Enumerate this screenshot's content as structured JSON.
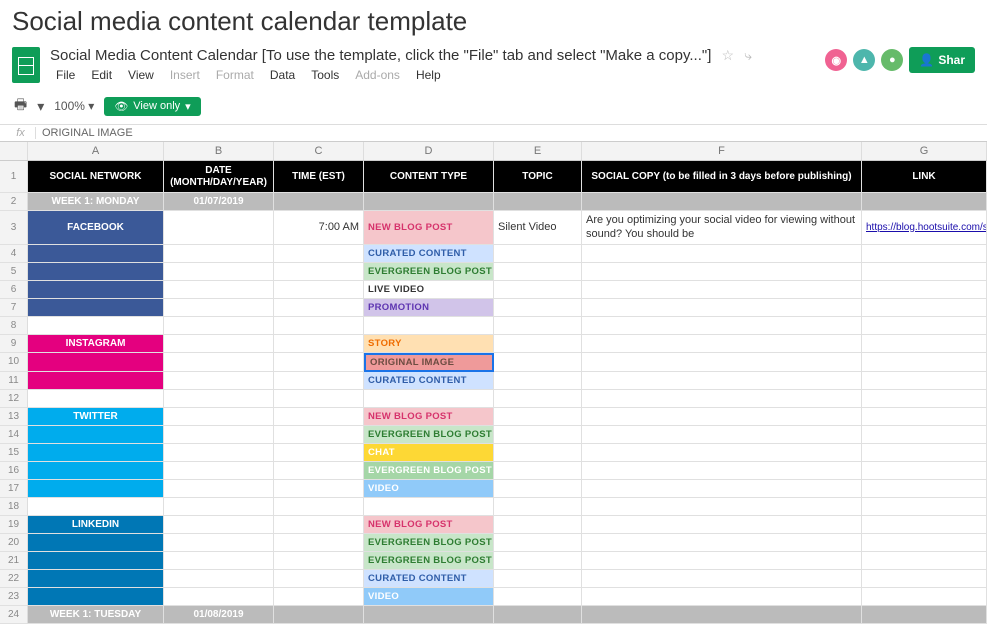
{
  "page_title": "Social media content calendar template",
  "doc_title": "Social Media Content Calendar [To use the template, click the \"File\" tab and select \"Make a copy...\"]",
  "menus": [
    "File",
    "Edit",
    "View",
    "Insert",
    "Format",
    "Data",
    "Tools",
    "Add-ons",
    "Help"
  ],
  "menus_disabled": [
    "Insert",
    "Format",
    "Add-ons"
  ],
  "share_label": "Shar",
  "zoom": "100%",
  "view_only": "View only",
  "fx_value": "ORIGINAL IMAGE",
  "columns": [
    "",
    "A",
    "B",
    "C",
    "D",
    "E",
    "F",
    "G"
  ],
  "headers": {
    "A": "SOCIAL NETWORK",
    "B": "DATE\n(MONTH/DAY/YEAR)",
    "C": "TIME (EST)",
    "D": "CONTENT TYPE",
    "E": "TOPIC",
    "F": "SOCIAL COPY (to be filled in 3 days before publishing)",
    "G": "LINK"
  },
  "rows": [
    {
      "n": 2,
      "type": "day",
      "A": "WEEK 1: MONDAY",
      "B": "01/07/2019"
    },
    {
      "n": 3,
      "type": "data",
      "network": "fb",
      "A": "FACEBOOK",
      "C": "7:00 AM",
      "D": "NEW BLOG POST",
      "Dclass": "ct-new",
      "E": "Silent Video",
      "F": "Are you optimizing your social video for viewing without sound? You should be",
      "G": "https://blog.hootsuite.com/silent"
    },
    {
      "n": 4,
      "type": "data",
      "network": "fb",
      "D": "CURATED CONTENT",
      "Dclass": "ct-curated"
    },
    {
      "n": 5,
      "type": "data",
      "network": "fb",
      "D": "EVERGREEN BLOG POST",
      "Dclass": "ct-evergreen"
    },
    {
      "n": 6,
      "type": "data",
      "network": "fb",
      "D": "LIVE VIDEO",
      "Dclass": "ct-live"
    },
    {
      "n": 7,
      "type": "data",
      "network": "fb",
      "D": "PROMOTION",
      "Dclass": "ct-promo"
    },
    {
      "n": 8,
      "type": "blank"
    },
    {
      "n": 9,
      "type": "data",
      "network": "ig",
      "A": "INSTAGRAM",
      "D": "STORY",
      "Dclass": "ct-story"
    },
    {
      "n": 10,
      "type": "data",
      "network": "ig",
      "D": "ORIGINAL IMAGE",
      "Dclass": "ct-original"
    },
    {
      "n": 11,
      "type": "data",
      "network": "ig",
      "D": "CURATED CONTENT",
      "Dclass": "ct-curated"
    },
    {
      "n": 12,
      "type": "blank"
    },
    {
      "n": 13,
      "type": "data",
      "network": "tw",
      "A": "TWITTER",
      "D": "NEW BLOG POST",
      "Dclass": "ct-new"
    },
    {
      "n": 14,
      "type": "data",
      "network": "tw",
      "D": "EVERGREEN BLOG POST",
      "Dclass": "ct-evergreen"
    },
    {
      "n": 15,
      "type": "data",
      "network": "tw",
      "D": "CHAT",
      "Dclass": "ct-chat"
    },
    {
      "n": 16,
      "type": "data",
      "network": "tw",
      "D": "EVERGREEN BLOG POST",
      "Dclass": "ct-evergreen2"
    },
    {
      "n": 17,
      "type": "data",
      "network": "tw",
      "D": "VIDEO",
      "Dclass": "ct-video"
    },
    {
      "n": 18,
      "type": "blank"
    },
    {
      "n": 19,
      "type": "data",
      "network": "li",
      "A": "LINKEDIN",
      "D": "NEW BLOG POST",
      "Dclass": "ct-new"
    },
    {
      "n": 20,
      "type": "data",
      "network": "li",
      "D": "EVERGREEN BLOG POST",
      "Dclass": "ct-evergreen"
    },
    {
      "n": 21,
      "type": "data",
      "network": "li",
      "D": "EVERGREEN BLOG POST",
      "Dclass": "ct-evergreen"
    },
    {
      "n": 22,
      "type": "data",
      "network": "li",
      "D": "CURATED CONTENT",
      "Dclass": "ct-curated"
    },
    {
      "n": 23,
      "type": "data",
      "network": "li",
      "D": "VIDEO",
      "Dclass": "ct-video"
    },
    {
      "n": 24,
      "type": "day",
      "A": "WEEK 1: TUESDAY",
      "B": "01/08/2019"
    }
  ]
}
